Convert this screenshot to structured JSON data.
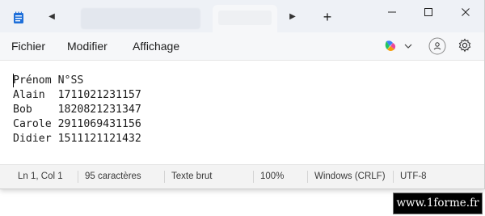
{
  "titlebar": {
    "tabs_scroll_left": "◀",
    "tabs_scroll_right": "▶",
    "new_tab": "+",
    "min_glyph": "—",
    "max_glyph": "☐",
    "close_glyph": "✕"
  },
  "menu": {
    "items": [
      "Fichier",
      "Modifier",
      "Affichage"
    ]
  },
  "toolbar_right": {
    "icons": [
      "copilot-icon",
      "chevron-down-icon",
      "account-icon",
      "gear-icon"
    ]
  },
  "editor": {
    "content": "Prénom N°SS\nAlain  1711021231157\nBob    1820821231347\nCarole 2911069431156\nDidier 1511121121432"
  },
  "status": {
    "position": "Ln 1, Col 1",
    "chars": "95 caractères",
    "format": "Texte brut",
    "zoom": "100%",
    "line_endings": "Windows (CRLF)",
    "encoding": "UTF-8"
  },
  "watermark": "www.1forme.fr",
  "colors": {
    "titlebar_bg": "#eef1f6",
    "menubar_bg": "#f6f7f9",
    "editor_bg": "#ffffff",
    "statusbar_bg": "#f3f3f3",
    "app_icon": "#1e6fd9"
  }
}
